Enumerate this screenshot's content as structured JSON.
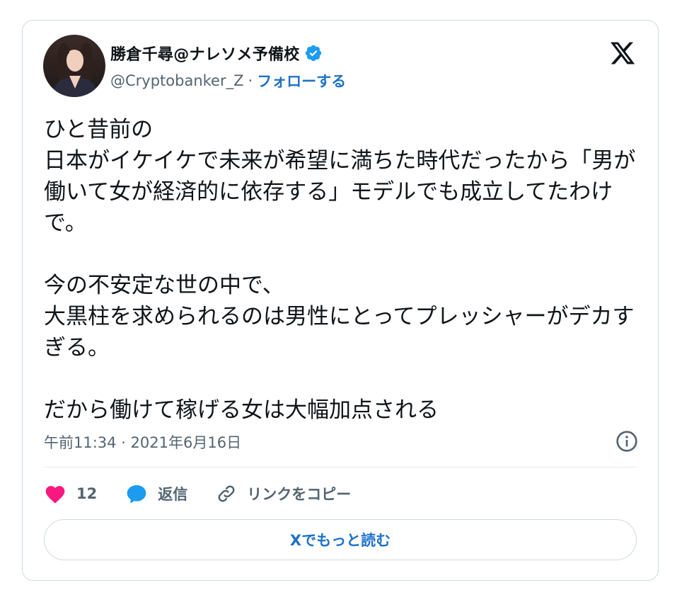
{
  "author": {
    "display_name": "勝倉千尋@ナレソメ予備校",
    "handle": "@Cryptobanker_Z",
    "separator": "·",
    "follow_label": "フォローする"
  },
  "tweet": {
    "paragraphs": [
      "ひと昔前の\n日本がイケイケで未来が希望に満ちた時代だったから「男が働いて女が経済的に依存する」モデルでも成立してたわけで。",
      "今の不安定な世の中で、\n大黒柱を求められるのは男性にとってプレッシャーがデカすぎる。",
      "だから働けて稼げる女は大幅加点される"
    ],
    "timestamp": "午前11:34 · 2021年6月16日"
  },
  "actions": {
    "like_count": "12",
    "reply_label": "返信",
    "copy_link_label": "リンクをコピー"
  },
  "cta_label": "Xでもっと読む",
  "colors": {
    "accent": "#1d72c9",
    "like": "#f91880",
    "verified": "#1d9bf0",
    "muted": "#536471",
    "border": "#cfd9de"
  },
  "icons": [
    "verified-badge-icon",
    "x-logo-icon",
    "info-icon",
    "heart-icon",
    "reply-bubble-icon",
    "link-icon"
  ]
}
